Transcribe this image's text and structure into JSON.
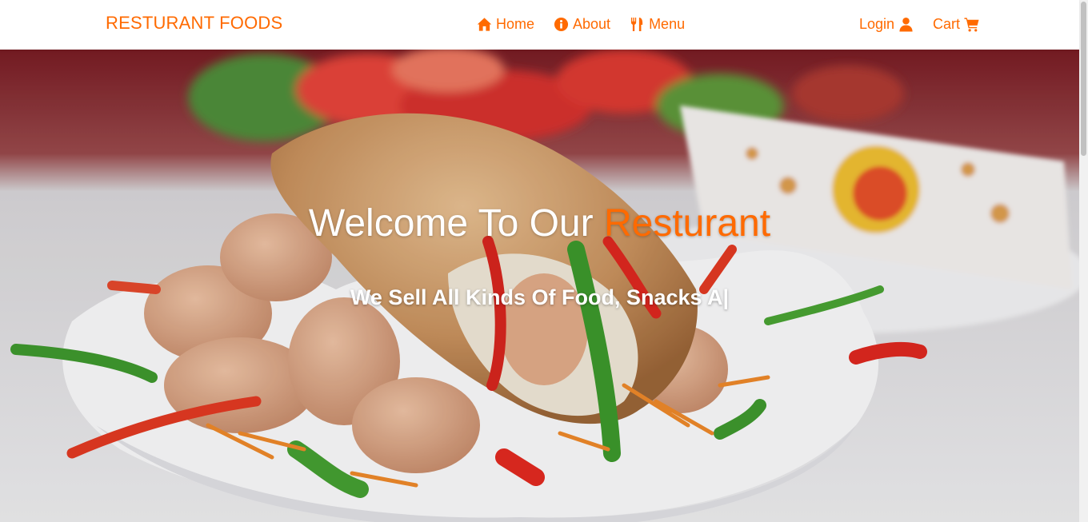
{
  "navbar": {
    "brand": "RESTURANT FOODS",
    "links": [
      {
        "label": "Home",
        "icon": "home-icon"
      },
      {
        "label": "About",
        "icon": "info-circle-icon"
      },
      {
        "label": "Menu",
        "icon": "utensils-icon"
      }
    ],
    "login": {
      "label": "Login",
      "icon": "user-icon"
    },
    "cart": {
      "label": "Cart",
      "icon": "shopping-cart-icon"
    }
  },
  "hero": {
    "title_prefix": "Welcome To Our",
    "title_accent": "Resturant",
    "subtitle": "We Sell All Kinds Of Food, Snacks A|",
    "background_description_icon": "shawarma-photo"
  },
  "colors": {
    "accent": "#ff6a00",
    "navbar_bg": "#ffffff",
    "hero_text": "#ffffff"
  }
}
